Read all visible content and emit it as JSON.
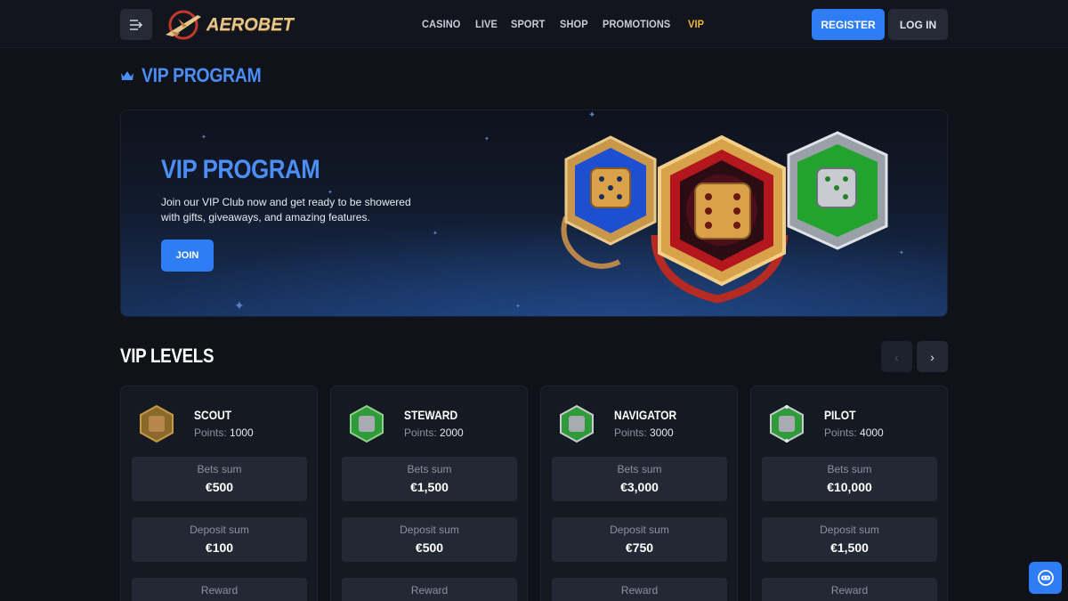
{
  "header": {
    "brand": "AEROBET",
    "nav": [
      {
        "label": "CASINO",
        "active": false
      },
      {
        "label": "LIVE",
        "active": false
      },
      {
        "label": "SPORT",
        "active": false
      },
      {
        "label": "SHOP",
        "active": false
      },
      {
        "label": "PROMOTIONS",
        "active": false
      },
      {
        "label": "VIP",
        "active": true
      }
    ],
    "register_label": "REGISTER",
    "login_label": "LOG IN"
  },
  "page_title": "VIP PROGRAM",
  "banner": {
    "title": "VIP PROGRAM",
    "text": "Join our VIP Club now and get ready to be showered with gifts, giveaways, and amazing features.",
    "join_label": "JOIN"
  },
  "levels": {
    "title": "VIP LEVELS",
    "prev_icon": "chevron-left-icon",
    "next_icon": "chevron-right-icon",
    "points_label": "Points:",
    "cards": [
      {
        "name": "SCOUT",
        "points": "1000",
        "icon_color": "#8a6a2a",
        "stats": [
          {
            "label": "Bets sum",
            "value": "€500"
          },
          {
            "label": "Deposit sum",
            "value": "€100"
          },
          {
            "label": "Reward",
            "value": ""
          }
        ]
      },
      {
        "name": "STEWARD",
        "points": "2000",
        "icon_color": "#2f9a3a",
        "stats": [
          {
            "label": "Bets sum",
            "value": "€1,500"
          },
          {
            "label": "Deposit sum",
            "value": "€500"
          },
          {
            "label": "Reward",
            "value": ""
          }
        ]
      },
      {
        "name": "NAVIGATOR",
        "points": "3000",
        "icon_color": "#2f9a3a",
        "stats": [
          {
            "label": "Bets sum",
            "value": "€3,000"
          },
          {
            "label": "Deposit sum",
            "value": "€750"
          },
          {
            "label": "Reward",
            "value": ""
          }
        ]
      },
      {
        "name": "PILOT",
        "points": "4000",
        "icon_color": "#2f9a3a",
        "stats": [
          {
            "label": "Bets sum",
            "value": "€10,000"
          },
          {
            "label": "Deposit sum",
            "value": "€1,500"
          },
          {
            "label": "Reward",
            "value": ""
          }
        ]
      }
    ]
  },
  "colors": {
    "accent": "#2f7df4",
    "title_blue": "#4c8df6",
    "active_nav": "#f0b93a",
    "background": "#0f1219"
  }
}
